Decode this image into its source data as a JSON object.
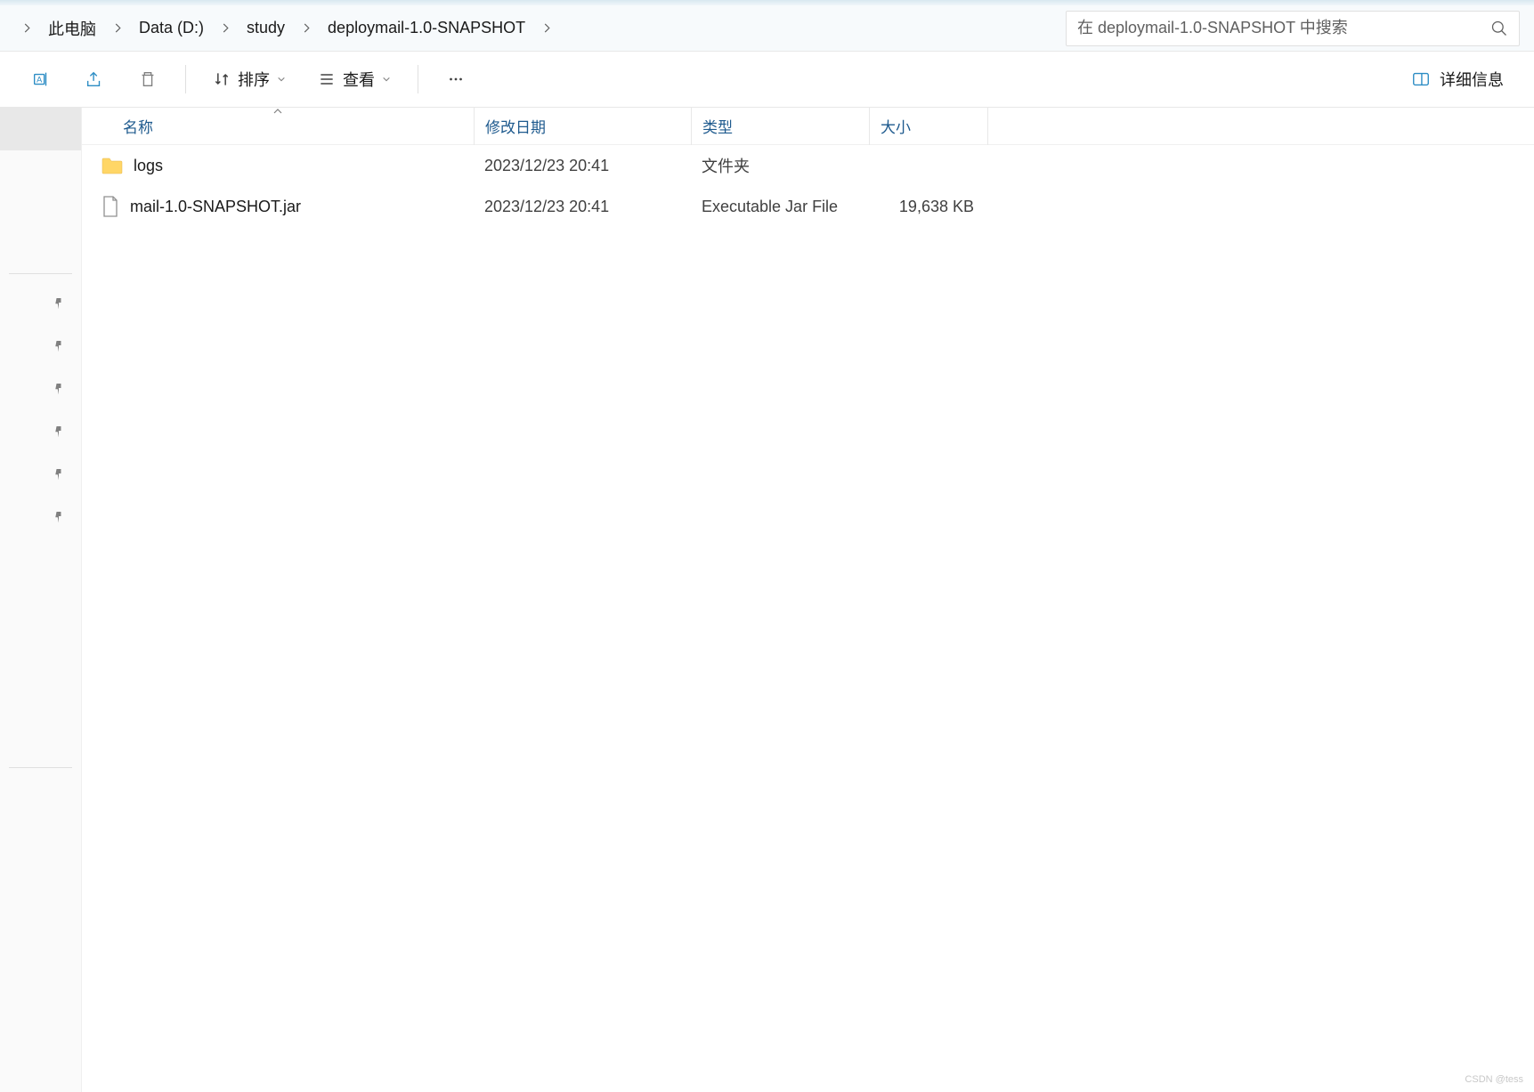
{
  "breadcrumb": {
    "items": [
      {
        "label": "此电脑"
      },
      {
        "label": "Data (D:)"
      },
      {
        "label": "study"
      },
      {
        "label": "deploymail-1.0-SNAPSHOT"
      }
    ]
  },
  "search": {
    "placeholder": "在 deploymail-1.0-SNAPSHOT 中搜索"
  },
  "toolbar": {
    "sort_label": "排序",
    "view_label": "查看",
    "details_label": "详细信息"
  },
  "columns": {
    "name": "名称",
    "date": "修改日期",
    "type": "类型",
    "size": "大小"
  },
  "files": [
    {
      "icon": "folder",
      "name": "logs",
      "date": "2023/12/23 20:41",
      "type": "文件夹",
      "size": ""
    },
    {
      "icon": "file",
      "name": "mail-1.0-SNAPSHOT.jar",
      "date": "2023/12/23 20:41",
      "type": "Executable Jar File",
      "size": "19,638 KB"
    }
  ],
  "watermark": "CSDN @tess"
}
